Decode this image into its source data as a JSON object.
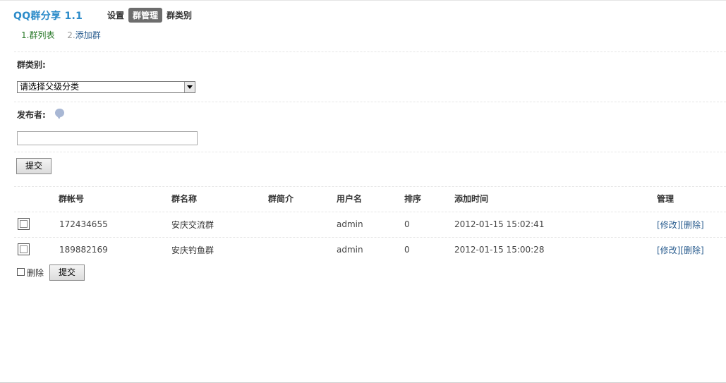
{
  "app": {
    "title": "QQ群分享  1.1"
  },
  "top_nav": [
    {
      "label": "设置",
      "active": false
    },
    {
      "label": "群管理",
      "active": true
    },
    {
      "label": "群类别",
      "active": false
    }
  ],
  "sub_nav": [
    {
      "num": "1.",
      "label": "群列表",
      "current": true
    },
    {
      "num": "2.",
      "label": "添加群",
      "current": false
    }
  ],
  "filter": {
    "category_label": "群类别:",
    "category_selected": "请选择父级分类",
    "publisher_label": "发布者:",
    "publisher_value": "",
    "submit_label": "提交"
  },
  "table": {
    "headers": {
      "account": "群帐号",
      "name": "群名称",
      "intro": "群简介",
      "username": "用户名",
      "order": "排序",
      "added_time": "添加时间",
      "manage": "管理"
    },
    "rows": [
      {
        "account": "172434655",
        "name": "安庆交流群",
        "intro": "",
        "username": "admin",
        "order": "0",
        "added_time": "2012-01-15 15:02:41",
        "edit": "[修改]",
        "delete": "[删除]"
      },
      {
        "account": "189882169",
        "name": "安庆钓鱼群",
        "intro": "",
        "username": "admin",
        "order": "0",
        "added_time": "2012-01-15 15:00:28",
        "edit": "[修改]",
        "delete": "[删除]"
      }
    ]
  },
  "bulk": {
    "delete_label": "删除",
    "submit_label": "提交"
  },
  "icons": {
    "help": "help-bubble-icon",
    "dropdown": "chevron-down-icon"
  }
}
